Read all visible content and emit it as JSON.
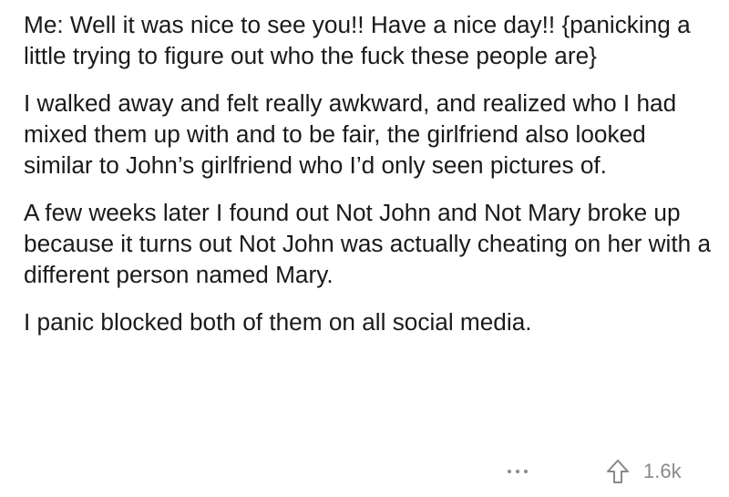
{
  "post": {
    "paragraphs": [
      "Me: Well it was nice to see you!! Have a nice day!! {panicking a little trying to figure out who the fuck these people are}",
      "I walked away and felt really awkward, and realized who I had mixed them up with and to be fair, the girlfriend also looked similar to John’s girlfriend who I’d only seen pictures of.",
      "A few weeks later I found out Not John and Not Mary broke up because it turns out Not John was actually cheating on her with a different person named Mary.",
      "I panic blocked both of them on all social media."
    ]
  },
  "footer": {
    "more_icon": "more-dots-icon",
    "upvote_icon": "upvote-arrow-icon",
    "upvote_count": "1.6k"
  },
  "colors": {
    "text": "#1a1a1b",
    "muted": "#878a8c",
    "background": "#ffffff"
  }
}
